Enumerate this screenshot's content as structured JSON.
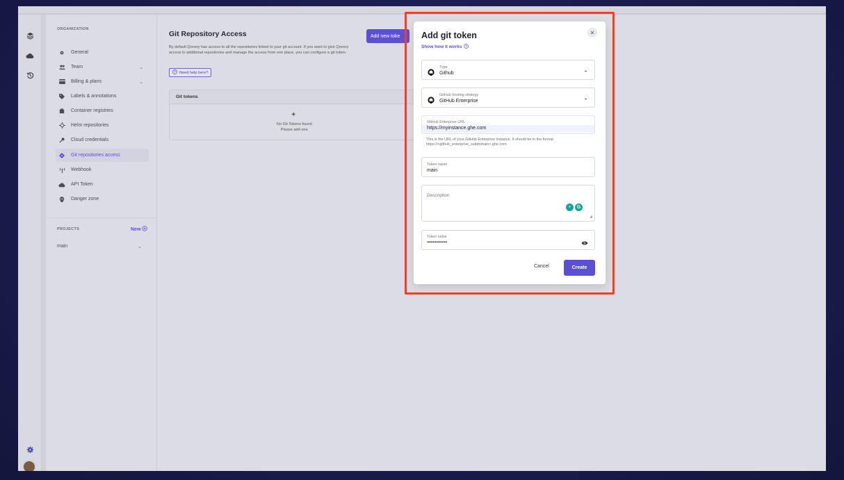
{
  "sidebar": {
    "org_section": "ORGANIZATION",
    "items": [
      {
        "label": "General",
        "icon": "gear-icon"
      },
      {
        "label": "Team",
        "icon": "users-icon"
      },
      {
        "label": "Billing & plans",
        "icon": "credit-card-icon"
      },
      {
        "label": "Labels & annotations",
        "icon": "tag-icon"
      },
      {
        "label": "Container registries",
        "icon": "box-icon"
      },
      {
        "label": "Helm repositories",
        "icon": "helm-icon"
      },
      {
        "label": "Cloud credentials",
        "icon": "key-icon"
      },
      {
        "label": "Git repositories access",
        "icon": "git-icon"
      },
      {
        "label": "Webhook",
        "icon": "antenna-icon"
      },
      {
        "label": "API Token",
        "icon": "cloud-key-icon"
      },
      {
        "label": "Danger zone",
        "icon": "skull-icon"
      }
    ],
    "projects_section": "PROJECTS",
    "new_label": "New",
    "project": "main"
  },
  "main": {
    "title": "Git Repository Access",
    "description": "By default Qovery has access to all the repositories linked to your git account. If you want to give Qovery access to additional repositories and manage the access from one place, you can configure a git token.",
    "help_label": "Need help here?",
    "add_button": "Add new toke",
    "tokens_header": "Git tokens",
    "empty_line1": "No Git Tokens found.",
    "empty_line2": "Please add one."
  },
  "modal": {
    "title": "Add git token",
    "link": "Show how it works",
    "type_label": "Type",
    "type_value": "Github",
    "strategy_label": "GitHub hosting strategy",
    "strategy_value": "GitHub Enterprise",
    "url_label": "GitHub Enterprise URL",
    "url_value": "https://myinstance.ghe.com",
    "url_hint": "This is the URL of your GitHub Enterprise instance. It should be in the format https://<github_enterprise_subdomain>.ghe.com",
    "name_label": "Token name",
    "name_value": "main",
    "description_label": "Description",
    "token_label": "Token value",
    "token_value": "••••••••••••••••••••",
    "cancel": "Cancel",
    "create": "Create"
  },
  "colors": {
    "accent": "#5b4fd3",
    "highlight": "#ff3b1f"
  }
}
